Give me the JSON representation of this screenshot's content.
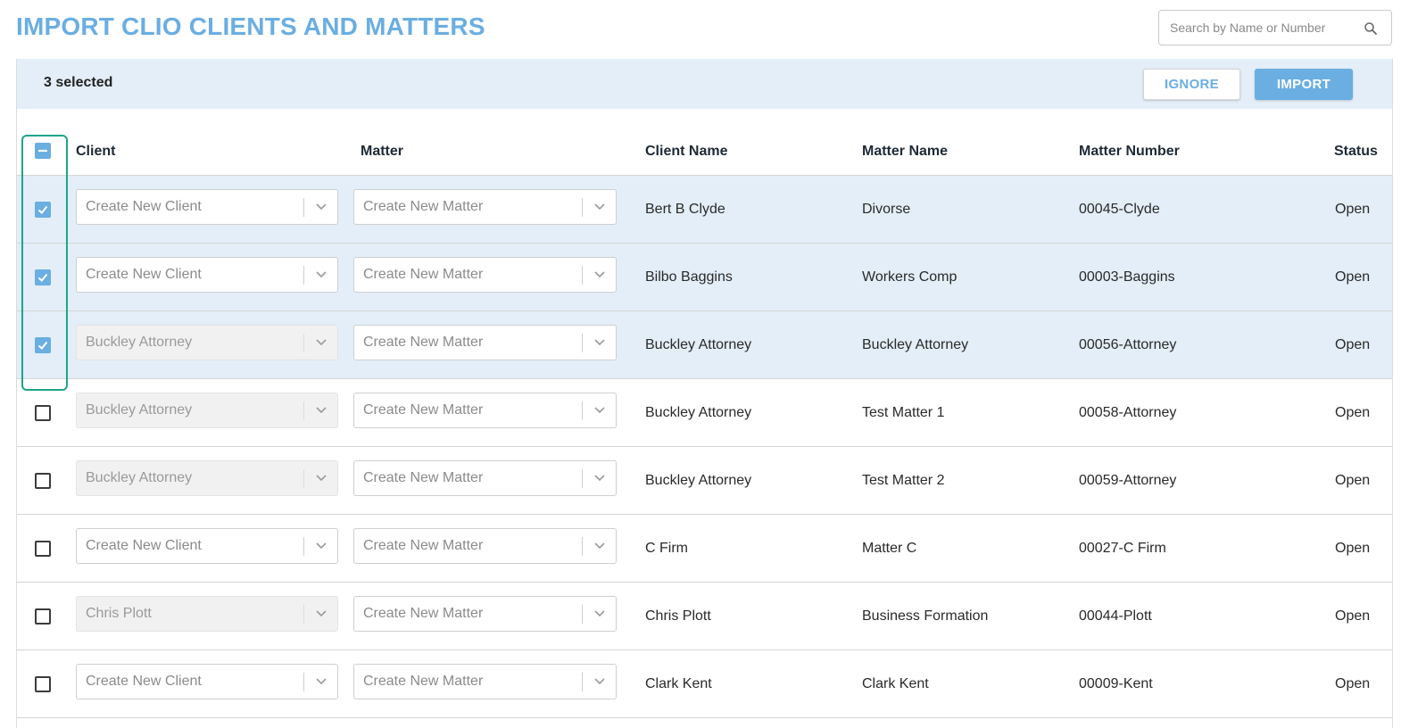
{
  "page": {
    "title": "IMPORT CLIO CLIENTS AND MATTERS"
  },
  "search": {
    "placeholder": "Search by Name or Number",
    "icon": "search-icon"
  },
  "toolbar": {
    "selected_text": "3 selected",
    "ignore_label": "IGNORE",
    "import_label": "IMPORT"
  },
  "colors": {
    "accent": "#6aaee2",
    "selected_row_bg": "#e3eef8",
    "highlight_outline": "#1fa58a"
  },
  "table": {
    "header_checkbox_state": "indeterminate",
    "columns": {
      "client": "Client",
      "matter": "Matter",
      "client_name": "Client Name",
      "matter_name": "Matter Name",
      "matter_number": "Matter Number",
      "status": "Status"
    },
    "rows": [
      {
        "checked": true,
        "client_select": "Create New Client",
        "client_select_disabled": false,
        "matter_select": "Create New Matter",
        "client_name": "Bert B Clyde",
        "matter_name": "Divorse",
        "matter_number": "00045-Clyde",
        "status": "Open"
      },
      {
        "checked": true,
        "client_select": "Create New Client",
        "client_select_disabled": false,
        "matter_select": "Create New Matter",
        "client_name": "Bilbo Baggins",
        "matter_name": "Workers Comp",
        "matter_number": "00003-Baggins",
        "status": "Open"
      },
      {
        "checked": true,
        "client_select": "Buckley Attorney",
        "client_select_disabled": true,
        "matter_select": "Create New Matter",
        "client_name": "Buckley Attorney",
        "matter_name": "Buckley Attorney",
        "matter_number": "00056-Attorney",
        "status": "Open"
      },
      {
        "checked": false,
        "client_select": "Buckley Attorney",
        "client_select_disabled": true,
        "matter_select": "Create New Matter",
        "client_name": "Buckley Attorney",
        "matter_name": "Test Matter 1",
        "matter_number": "00058-Attorney",
        "status": "Open"
      },
      {
        "checked": false,
        "client_select": "Buckley Attorney",
        "client_select_disabled": true,
        "matter_select": "Create New Matter",
        "client_name": "Buckley Attorney",
        "matter_name": "Test Matter 2",
        "matter_number": "00059-Attorney",
        "status": "Open"
      },
      {
        "checked": false,
        "client_select": "Create New Client",
        "client_select_disabled": false,
        "matter_select": "Create New Matter",
        "client_name": "C Firm",
        "matter_name": "Matter C",
        "matter_number": "00027-C Firm",
        "status": "Open"
      },
      {
        "checked": false,
        "client_select": "Chris Plott",
        "client_select_disabled": true,
        "matter_select": "Create New Matter",
        "client_name": "Chris Plott",
        "matter_name": "Business Formation",
        "matter_number": "00044-Plott",
        "status": "Open"
      },
      {
        "checked": false,
        "client_select": "Create New Client",
        "client_select_disabled": false,
        "matter_select": "Create New Matter",
        "client_name": "Clark Kent",
        "matter_name": "Clark Kent",
        "matter_number": "00009-Kent",
        "status": "Open"
      }
    ]
  }
}
